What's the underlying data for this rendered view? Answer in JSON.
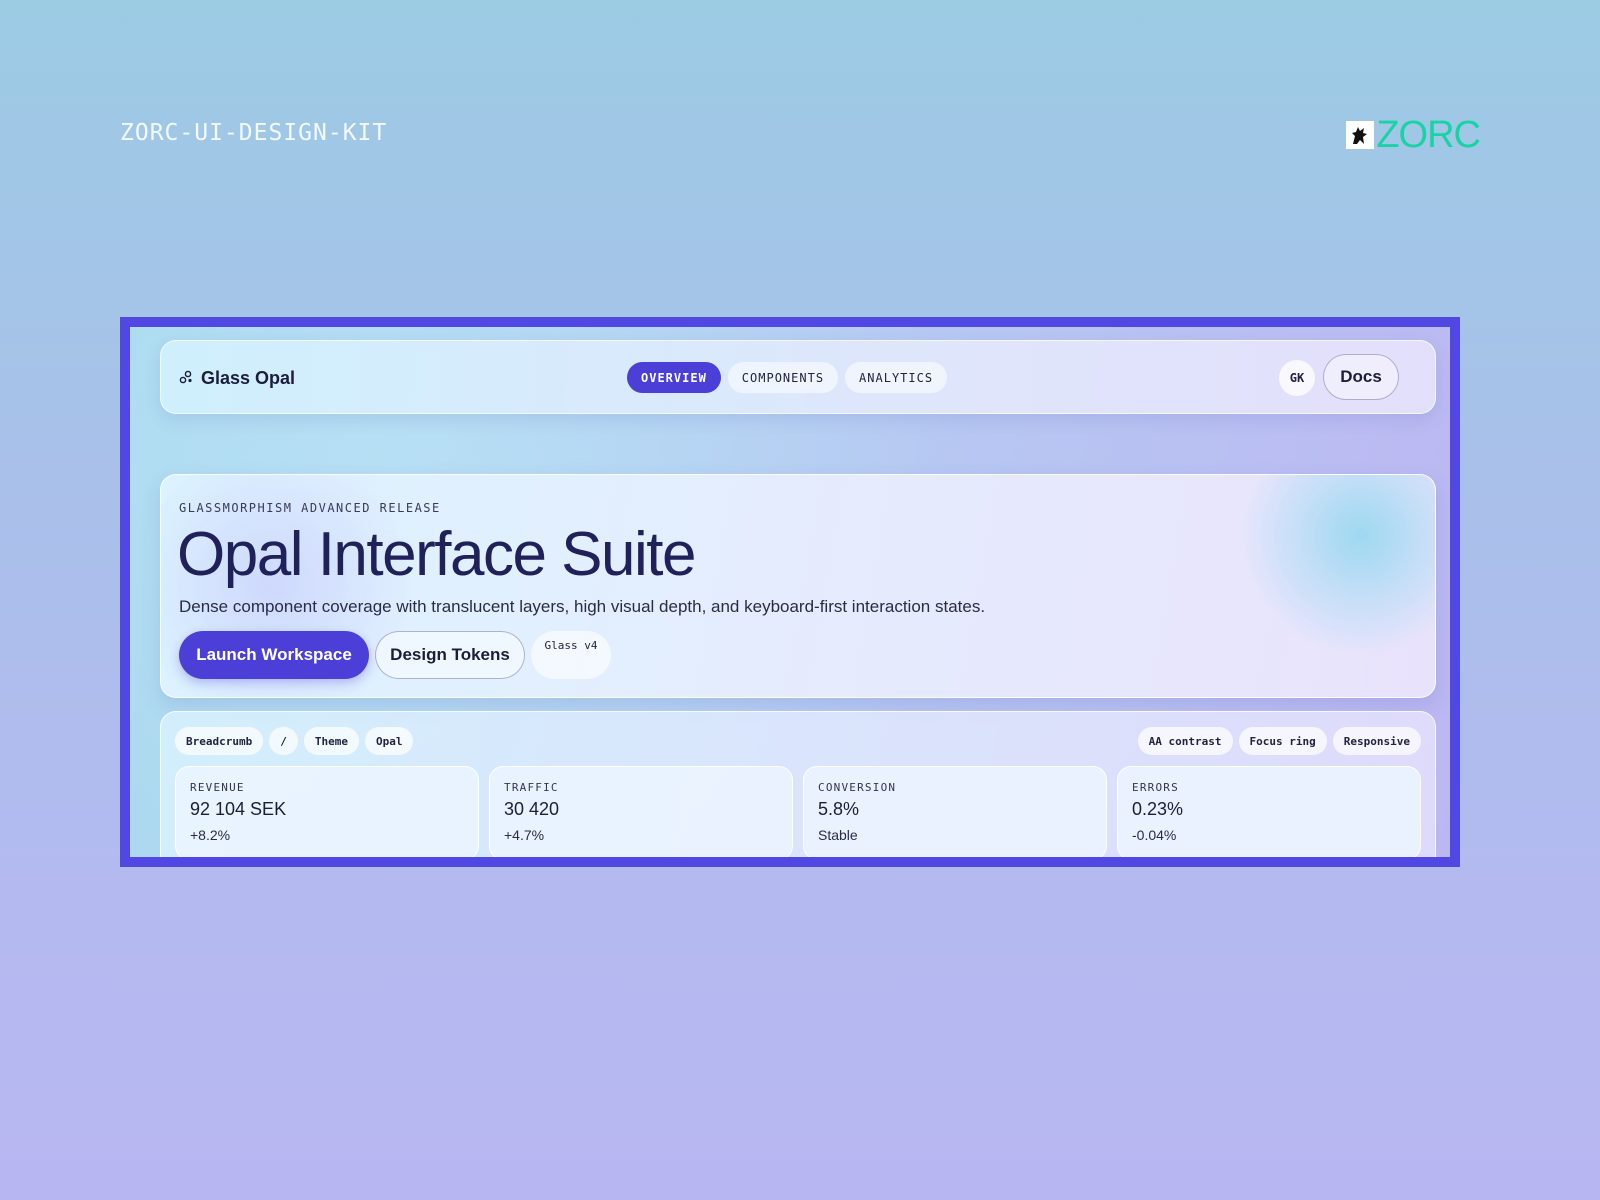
{
  "kit": {
    "title": "ZORC-UI-DESIGN-KIT",
    "brand": "ZORC",
    "brand_icon": "wolf-logo-icon"
  },
  "colors": {
    "accent": "#4b3fd8",
    "frame": "#5147e3",
    "brand": "#19d3a7",
    "heading": "#20205a"
  },
  "topbar": {
    "logo_icon": "molecule-icon",
    "logo_text": "Glass Opal",
    "tabs": [
      {
        "label": "OVERVIEW",
        "active": true
      },
      {
        "label": "COMPONENTS",
        "active": false
      },
      {
        "label": "ANALYTICS",
        "active": false
      }
    ],
    "avatar_initials": "GK",
    "docs_label": "Docs"
  },
  "hero": {
    "eyebrow": "GLASSMORPHISM ADVANCED RELEASE",
    "title": "Opal Interface Suite",
    "subtitle": "Dense component coverage with translucent layers, high visual depth, and keyboard-first interaction states.",
    "primary_label": "Launch Workspace",
    "secondary_label": "Design Tokens",
    "version_chip": "Glass v4"
  },
  "panel": {
    "breadcrumb": [
      "Breadcrumb",
      "/",
      "Theme",
      "Opal"
    ],
    "flags": [
      "AA contrast",
      "Focus ring",
      "Responsive"
    ],
    "metrics": [
      {
        "label": "REVENUE",
        "value": "92 104 SEK",
        "delta": "+8.2%"
      },
      {
        "label": "TRAFFIC",
        "value": "30 420",
        "delta": "+4.7%"
      },
      {
        "label": "CONVERSION",
        "value": "5.8%",
        "delta": "Stable"
      },
      {
        "label": "ERRORS",
        "value": "0.23%",
        "delta": "-0.04%"
      }
    ]
  }
}
